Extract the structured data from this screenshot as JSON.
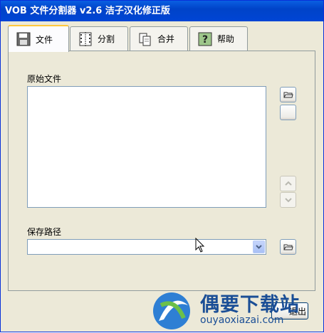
{
  "window": {
    "title": "VOB 文件分割器 v2.6 洁子汉化修正版"
  },
  "tabs": [
    {
      "label": "文件",
      "icon": "floppy-disk-icon",
      "active": true
    },
    {
      "label": "分割",
      "icon": "split-film-icon",
      "active": false
    },
    {
      "label": "合并",
      "icon": "merge-pages-icon",
      "active": false
    },
    {
      "label": "帮助",
      "icon": "help-question-icon",
      "active": false
    }
  ],
  "panel": {
    "source_label": "原始文件",
    "save_label": "保存路径",
    "save_path_value": ""
  },
  "buttons": {
    "exit_label": "退出"
  },
  "watermark": {
    "brand": "偶要下载站",
    "url": "ouyaoxiazai.com"
  }
}
